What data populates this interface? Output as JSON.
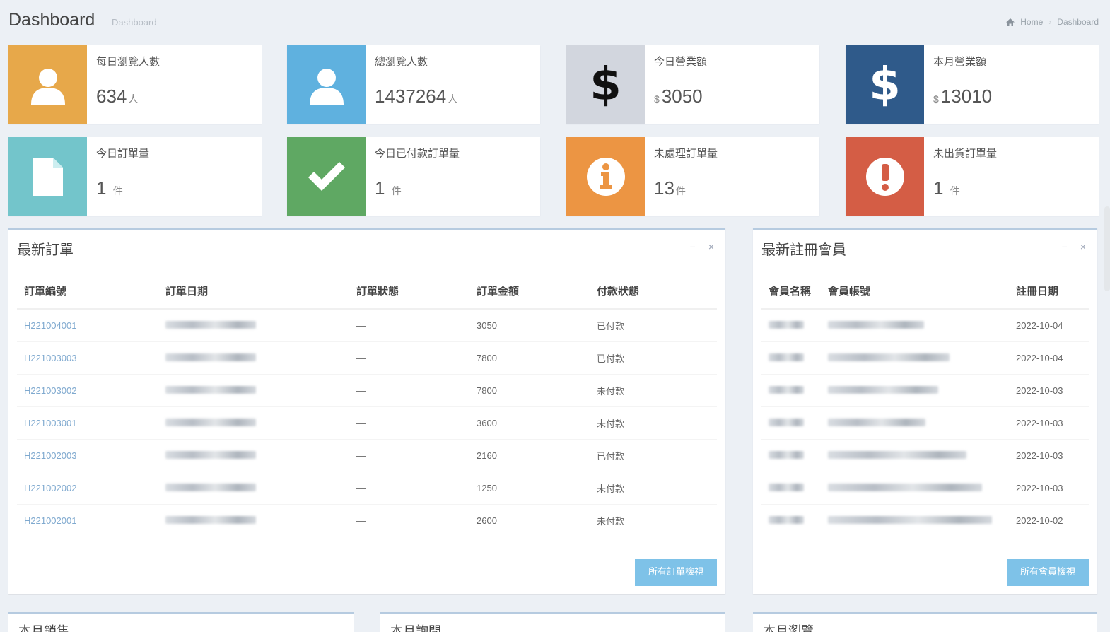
{
  "header": {
    "title": "Dashboard",
    "subtitle": "Dashboard",
    "breadcrumb": [
      "Home",
      "Dashboard"
    ]
  },
  "info_boxes": [
    {
      "label": "每日瀏覽人數",
      "value": "634",
      "prefix": "",
      "unit": "人",
      "color": "#e7a84a",
      "icon": "user-icon"
    },
    {
      "label": "總瀏覽人數",
      "value": "1437264",
      "prefix": "",
      "unit": "人",
      "color": "#5fb1df",
      "icon": "user-icon"
    },
    {
      "label": "今日營業額",
      "value": "3050",
      "prefix": "$",
      "unit": "",
      "color": "#d2d6de",
      "icon": "dollar-icon"
    },
    {
      "label": "本月營業額",
      "value": "13010",
      "prefix": "$",
      "unit": "",
      "color": "#2f5a8a",
      "icon": "dollar-icon"
    },
    {
      "label": "今日訂單量",
      "value": "1",
      "prefix": "",
      "unit": "件",
      "color": "#73c5cb",
      "icon": "file-icon"
    },
    {
      "label": "今日已付款訂單量",
      "value": "1",
      "prefix": "",
      "unit": "件",
      "color": "#5fa863",
      "icon": "check-icon"
    },
    {
      "label": "未處理訂單量",
      "value": "13",
      "prefix": "",
      "unit": "件",
      "color": "#ec9543",
      "icon": "info-icon"
    },
    {
      "label": "未出貨訂單量",
      "value": "1",
      "prefix": "",
      "unit": "件",
      "color": "#d45d45",
      "icon": "exclamation-icon"
    }
  ],
  "orders": {
    "title": "最新訂單",
    "columns": [
      "訂單編號",
      "訂單日期",
      "訂單狀態",
      "訂單金額",
      "付款狀態"
    ],
    "rows": [
      {
        "id": "H221004001",
        "status": "—",
        "amount": "3050",
        "payment": "已付款"
      },
      {
        "id": "H221003003",
        "status": "—",
        "amount": "7800",
        "payment": "已付款"
      },
      {
        "id": "H221003002",
        "status": "—",
        "amount": "7800",
        "payment": "未付款"
      },
      {
        "id": "H221003001",
        "status": "—",
        "amount": "3600",
        "payment": "未付款"
      },
      {
        "id": "H221002003",
        "status": "—",
        "amount": "2160",
        "payment": "已付款"
      },
      {
        "id": "H221002002",
        "status": "—",
        "amount": "1250",
        "payment": "未付款"
      },
      {
        "id": "H221002001",
        "status": "—",
        "amount": "2600",
        "payment": "未付款"
      }
    ],
    "button": "所有訂單檢視"
  },
  "members": {
    "title": "最新註冊會員",
    "columns": [
      "會員名稱",
      "會員帳號",
      "註冊日期"
    ],
    "rows": [
      {
        "date": "2022-10-04"
      },
      {
        "date": "2022-10-04"
      },
      {
        "date": "2022-10-03"
      },
      {
        "date": "2022-10-03"
      },
      {
        "date": "2022-10-03"
      },
      {
        "date": "2022-10-03"
      },
      {
        "date": "2022-10-02"
      }
    ],
    "button": "所有會員檢視"
  },
  "bottom_boxes": [
    "本月銷售......",
    "本月詢問......",
    "本月瀏覽......"
  ]
}
